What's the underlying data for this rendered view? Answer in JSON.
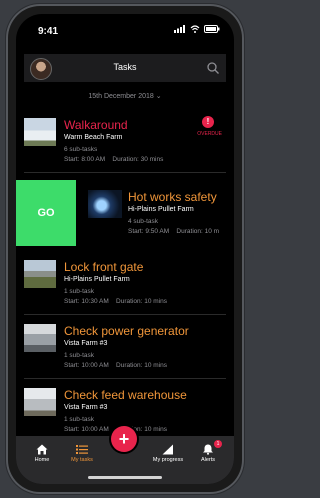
{
  "status": {
    "time": "9:41"
  },
  "header": {
    "title": "Tasks"
  },
  "date_filter": {
    "label": "15th December 2018"
  },
  "tasks": [
    {
      "title": "Walkaround",
      "farm": "Warm Beach Farm",
      "subtasks": "6 sub-tasks",
      "start": "Start: 8:00 AM",
      "duration": "Duration: 30 mins",
      "badge": "!",
      "badge_label": "OVERDUE",
      "title_color": "#e8244c"
    },
    {
      "title": "Hot works safety",
      "farm": "Hi-Plains Pullet Farm",
      "subtasks": "4 sub-task",
      "start": "Start: 9:50 AM",
      "duration": "Duration: 10 m",
      "title_color": "#f0963a"
    },
    {
      "title": "Lock front gate",
      "farm": "Hi-Plains Pullet Farm",
      "subtasks": "1 sub-task",
      "start": "Start: 10:30 AM",
      "duration": "Duration: 10 mins",
      "title_color": "#f0963a"
    },
    {
      "title": "Check power generator",
      "farm": "Vista Farm #3",
      "subtasks": "1 sub-task",
      "start": "Start: 10:00 AM",
      "duration": "Duration: 10 mins",
      "title_color": "#f0963a"
    },
    {
      "title": "Check feed warehouse",
      "farm": "Vista Farm #3",
      "subtasks": "1 sub-task",
      "start": "Start: 10:00 AM",
      "duration": "Duration: 10 mins",
      "title_color": "#f0963a"
    }
  ],
  "swipe_action": {
    "label": "GO",
    "color": "#3ddc6a"
  },
  "tabbar": {
    "home": "Home",
    "mytasks": "My tasks",
    "progress": "My progress",
    "alerts": "Alerts",
    "alerts_count": "1",
    "fab": "+"
  },
  "colors": {
    "accent": "#f0963a",
    "danger": "#e8244c",
    "go": "#3ddc6a"
  }
}
